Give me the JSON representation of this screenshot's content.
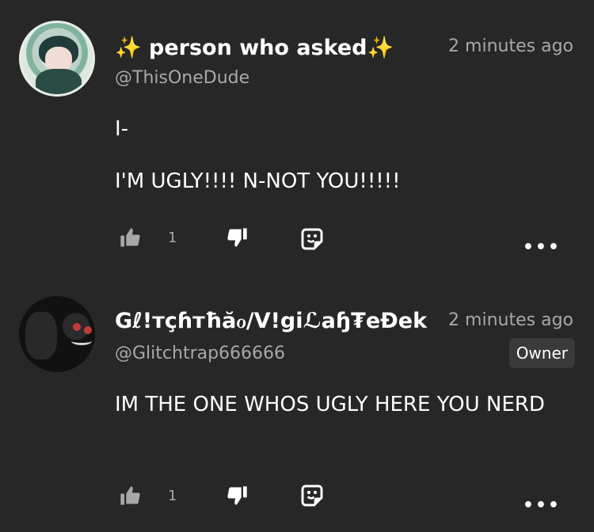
{
  "comments": [
    {
      "display_name": "✨ person who asked✨",
      "handle": "@ThisOneDude",
      "time": "2 minutes ago",
      "body": [
        "I-",
        "I'M UGLY!!!! N-NOT YOU!!!!!"
      ],
      "likes": "1"
    },
    {
      "display_name": "Gℓ!тçɦтħăℴ/V!giℒaɧ₮eĐek",
      "handle": "@Glitchtrap666666",
      "time": "2 minutes ago",
      "badge": "Owner",
      "body": [
        "IM THE ONE WHOS UGLY HERE YOU NERD"
      ],
      "likes": "1"
    }
  ],
  "icons": [
    "like-icon",
    "dislike-icon",
    "sticker-reply-icon",
    "more-options-icon"
  ],
  "colors": {
    "background": "#272727",
    "secondary_text": "#a8a8a8",
    "badge_bg": "#3a3a3a"
  }
}
